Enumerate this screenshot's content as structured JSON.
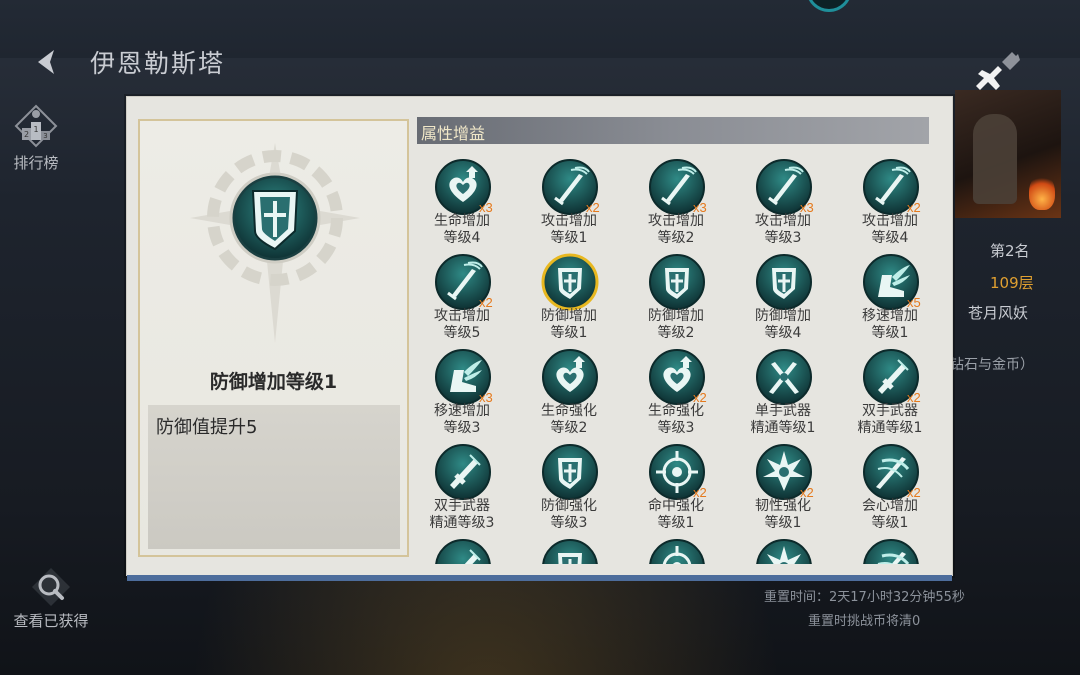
{
  "header": {
    "title": "伊恩勒斯塔"
  },
  "side": {
    "rank_label": "排行榜",
    "rank_icon": "podium-icon",
    "owned_label": "查看已获得",
    "owned_icon": "magnifier-icon"
  },
  "right_info": {
    "rank": "第2名",
    "floor": "109层",
    "name": "苍月风妖",
    "reward": "钻石与金币）"
  },
  "footer": {
    "reset_time": "重置时间：2天17小时32分钟55秒",
    "reset_note": "重置时挑战币将清0"
  },
  "detail": {
    "name": "防御增加等级1",
    "description": "防御值提升5",
    "icon": "shield-icon"
  },
  "section": {
    "title": "属性增益"
  },
  "colors": {
    "accent_orange": "#e57a1e",
    "selected_ring": "#e8b820",
    "icon_teal": "#1f6d70",
    "icon_glow": "#9fe6df"
  },
  "buffs": [
    {
      "label": "生命增加\n等级4",
      "count": "x3",
      "icon": "heart-up-icon"
    },
    {
      "label": "攻击增加\n等级1",
      "count": "x2",
      "icon": "sword-icon"
    },
    {
      "label": "攻击增加\n等级2",
      "count": "x3",
      "icon": "sword-icon"
    },
    {
      "label": "攻击增加\n等级3",
      "count": "x3",
      "icon": "sword-icon"
    },
    {
      "label": "攻击增加\n等级4",
      "count": "x2",
      "icon": "sword-icon"
    },
    {
      "label": "攻击增加\n等级5",
      "count": "x2",
      "icon": "sword-icon"
    },
    {
      "label": "防御增加\n等级1",
      "count": "",
      "icon": "shield-icon",
      "selected": true
    },
    {
      "label": "防御增加\n等级2",
      "count": "",
      "icon": "shield-icon"
    },
    {
      "label": "防御增加\n等级4",
      "count": "",
      "icon": "shield-icon"
    },
    {
      "label": "移速增加\n等级1",
      "count": "x5",
      "icon": "winged-boot-icon"
    },
    {
      "label": "移速增加\n等级3",
      "count": "x3",
      "icon": "winged-boot-icon"
    },
    {
      "label": "生命强化\n等级2",
      "count": "",
      "icon": "heart-up-icon"
    },
    {
      "label": "生命强化\n等级3",
      "count": "x2",
      "icon": "heart-up-icon"
    },
    {
      "label": "单手武器\n精通等级1",
      "count": "",
      "icon": "crossed-swords-icon"
    },
    {
      "label": "双手武器\n精通等级1",
      "count": "x2",
      "icon": "greatsword-icon"
    },
    {
      "label": "双手武器\n精通等级3",
      "count": "",
      "icon": "greatsword-icon"
    },
    {
      "label": "防御强化\n等级3",
      "count": "",
      "icon": "shield-icon"
    },
    {
      "label": "命中强化\n等级1",
      "count": "x2",
      "icon": "crosshair-icon"
    },
    {
      "label": "韧性强化\n等级1",
      "count": "x2",
      "icon": "burst-icon"
    },
    {
      "label": "会心增加\n等级1",
      "count": "x2",
      "icon": "slash-icon"
    },
    {
      "label": "",
      "count": "",
      "icon": "greatsword-icon"
    },
    {
      "label": "",
      "count": "",
      "icon": "shield-icon"
    },
    {
      "label": "",
      "count": "",
      "icon": "crosshair-icon"
    },
    {
      "label": "",
      "count": "",
      "icon": "burst-icon"
    },
    {
      "label": "",
      "count": "",
      "icon": "slash-icon"
    }
  ]
}
